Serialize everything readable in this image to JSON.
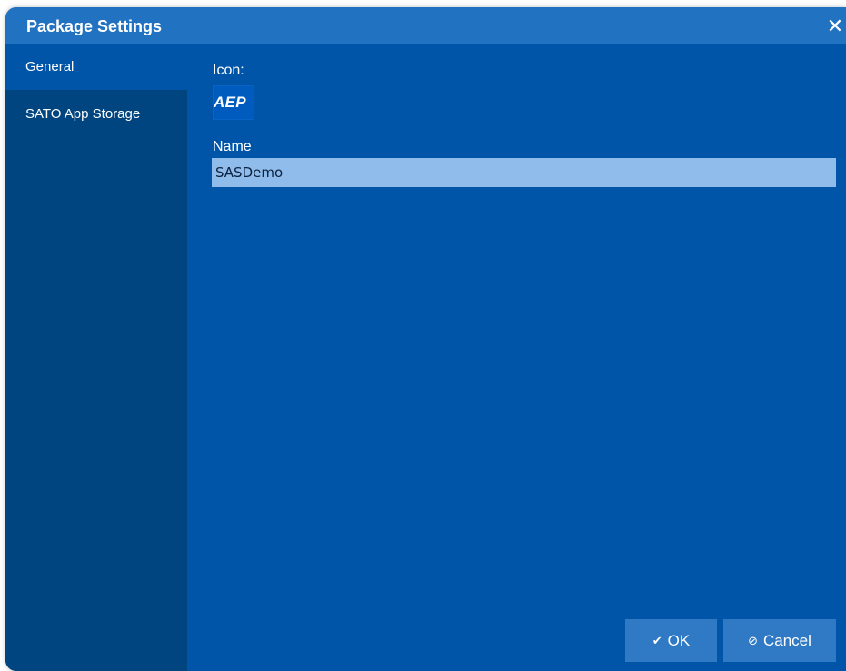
{
  "dialog": {
    "title": "Package Settings",
    "close_glyph": "✕"
  },
  "sidebar": {
    "items": [
      {
        "label": "General",
        "active": true
      },
      {
        "label": "SATO App Storage",
        "active": false
      }
    ]
  },
  "general": {
    "icon_label": "Icon:",
    "icon_text": "AEP",
    "name_label": "Name",
    "name_value": "SASDemo"
  },
  "buttons": {
    "ok_icon": "✔",
    "ok_label": "OK",
    "cancel_icon": "⊘",
    "cancel_label": "Cancel"
  },
  "colors": {
    "content_bg": "#0055a8",
    "titlebar_bg": "#2172c1",
    "sidebar_bg": "#00457f",
    "input_bg": "#8fbcea",
    "button_bg": "#2f79c5"
  }
}
